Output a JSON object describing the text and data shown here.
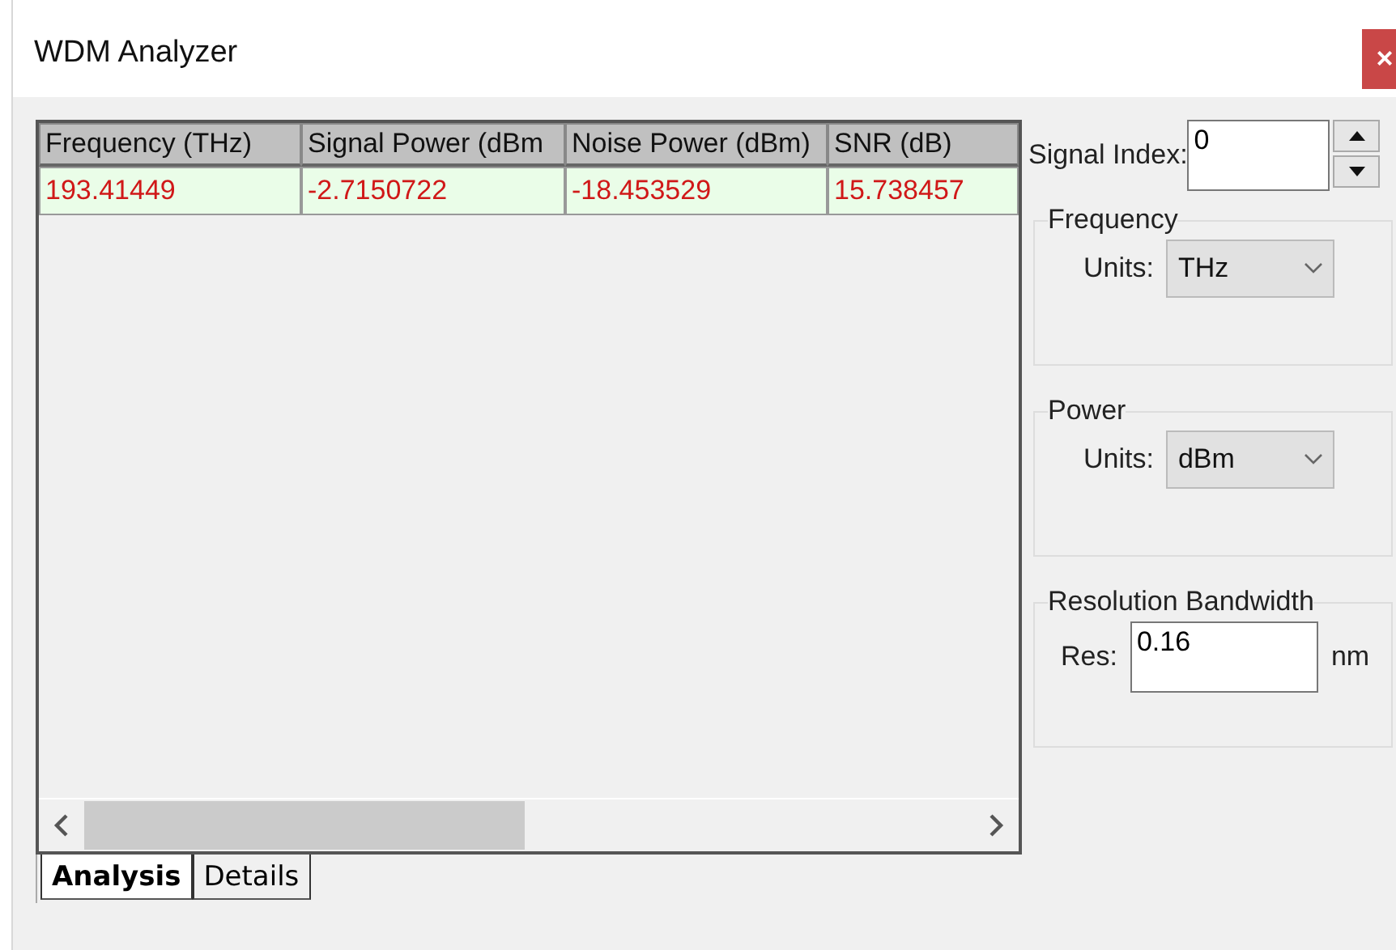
{
  "window": {
    "title": "WDM Analyzer",
    "close": "×"
  },
  "table": {
    "columns": [
      "Frequency (THz)",
      "Signal Power (dBm",
      "Noise Power (dBm)",
      "SNR (dB)"
    ],
    "rows": [
      {
        "cells": [
          "193.41449",
          "-2.7150722",
          "-18.453529",
          "15.738457"
        ],
        "selected": true
      }
    ]
  },
  "tabs": [
    {
      "label": "Analysis",
      "selected": true
    },
    {
      "label": "Details",
      "selected": false
    }
  ],
  "signal_index": {
    "label": "Signal Index:",
    "value": "0"
  },
  "frequency": {
    "title": "Frequency",
    "units_label": "Units:",
    "units": "THz"
  },
  "power": {
    "title": "Power",
    "units_label": "Units:",
    "units": "dBm"
  },
  "resolution": {
    "title": "Resolution Bandwidth",
    "label": "Res:",
    "value": "0.16",
    "unit": "nm"
  }
}
